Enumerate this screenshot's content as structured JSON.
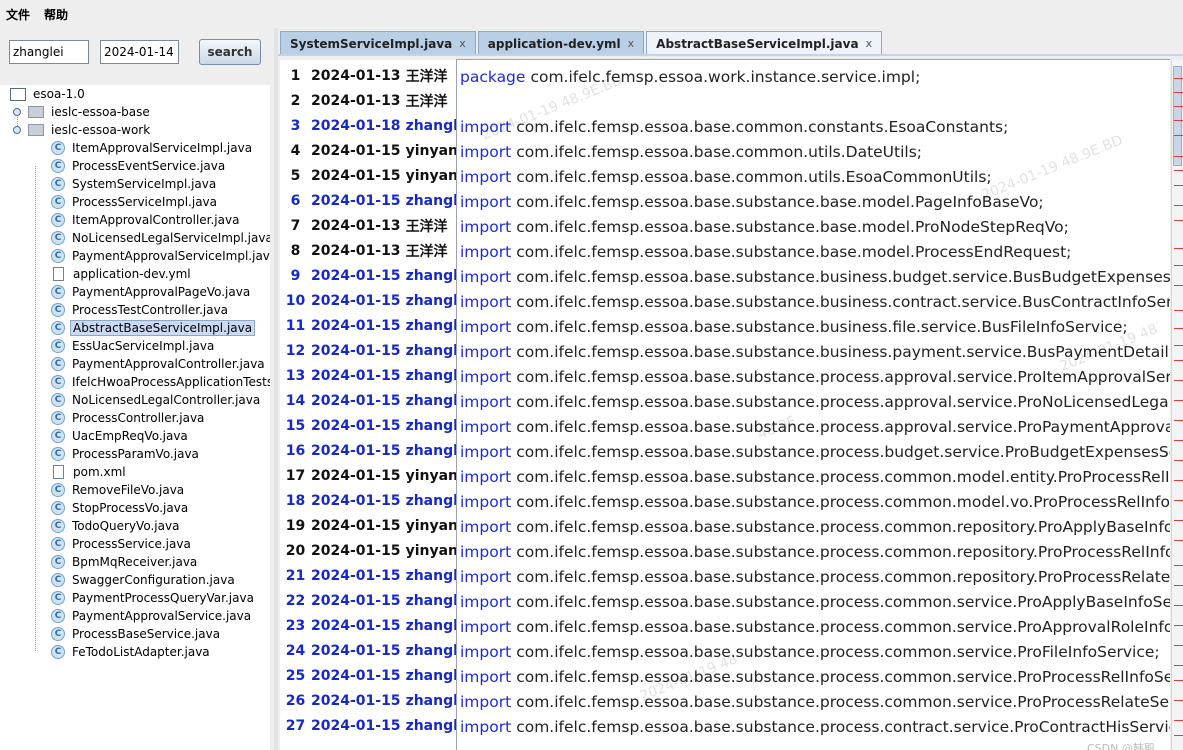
{
  "menu": {
    "items": [
      "文件",
      "帮助"
    ]
  },
  "search": {
    "user_value": "zhanglei",
    "date_value": "2024-01-14",
    "button_label": "search"
  },
  "tree": {
    "root": "esoa-1.0",
    "modules": [
      "ieslc-essoa-base",
      "ieslc-essoa-work"
    ],
    "files": [
      {
        "name": "ItemApprovalServiceImpl.java",
        "type": "class"
      },
      {
        "name": "ProcessEventService.java",
        "type": "class"
      },
      {
        "name": "SystemServiceImpl.java",
        "type": "class"
      },
      {
        "name": "ProcessServiceImpl.java",
        "type": "class"
      },
      {
        "name": "ItemApprovalController.java",
        "type": "class"
      },
      {
        "name": "NoLicensedLegalServiceImpl.java",
        "type": "class"
      },
      {
        "name": "PaymentApprovalServiceImpl.java",
        "type": "class"
      },
      {
        "name": "application-dev.yml",
        "type": "file"
      },
      {
        "name": "PaymentApprovalPageVo.java",
        "type": "class"
      },
      {
        "name": "ProcessTestController.java",
        "type": "class"
      },
      {
        "name": "AbstractBaseServiceImpl.java",
        "type": "class",
        "selected": true
      },
      {
        "name": "EssUacServiceImpl.java",
        "type": "class"
      },
      {
        "name": "PaymentApprovalController.java",
        "type": "class"
      },
      {
        "name": "IfelcHwoaProcessApplicationTests.j",
        "type": "class"
      },
      {
        "name": "NoLicensedLegalController.java",
        "type": "class"
      },
      {
        "name": "ProcessController.java",
        "type": "class"
      },
      {
        "name": "UacEmpReqVo.java",
        "type": "class"
      },
      {
        "name": "ProcessParamVo.java",
        "type": "class"
      },
      {
        "name": "pom.xml",
        "type": "file"
      },
      {
        "name": "RemoveFileVo.java",
        "type": "class"
      },
      {
        "name": "StopProcessVo.java",
        "type": "class"
      },
      {
        "name": "TodoQueryVo.java",
        "type": "class"
      },
      {
        "name": "ProcessService.java",
        "type": "class"
      },
      {
        "name": "BpmMqReceiver.java",
        "type": "class"
      },
      {
        "name": "SwaggerConfiguration.java",
        "type": "class"
      },
      {
        "name": "PaymentProcessQueryVar.java",
        "type": "class"
      },
      {
        "name": "PaymentApprovalService.java",
        "type": "class"
      },
      {
        "name": "ProcessBaseService.java",
        "type": "class"
      },
      {
        "name": "FeTodoListAdapter.java",
        "type": "class"
      }
    ]
  },
  "tabs": [
    {
      "label": "SystemServiceImpl.java",
      "close": "x",
      "active": false
    },
    {
      "label": "application-dev.yml",
      "close": "x",
      "active": false
    },
    {
      "label": "AbstractBaseServiceImpl.java",
      "close": "x",
      "active": true
    }
  ],
  "blame": [
    {
      "line": "1",
      "date": "2024-01-13",
      "author": "王洋洋",
      "color": "black"
    },
    {
      "line": "2",
      "date": "2024-01-13",
      "author": "王洋洋",
      "color": "black"
    },
    {
      "line": "3",
      "date": "2024-01-18",
      "author": "zhanglei",
      "color": "blue"
    },
    {
      "line": "4",
      "date": "2024-01-15",
      "author": "yinyang",
      "color": "black"
    },
    {
      "line": "5",
      "date": "2024-01-15",
      "author": "yinyang",
      "color": "black"
    },
    {
      "line": "6",
      "date": "2024-01-15",
      "author": "zhanglei",
      "color": "blue"
    },
    {
      "line": "7",
      "date": "2024-01-13",
      "author": "王洋洋",
      "color": "black"
    },
    {
      "line": "8",
      "date": "2024-01-13",
      "author": "王洋洋",
      "color": "black"
    },
    {
      "line": "9",
      "date": "2024-01-15",
      "author": "zhanglei",
      "color": "blue"
    },
    {
      "line": "10",
      "date": "2024-01-15",
      "author": "zhanglei",
      "color": "blue"
    },
    {
      "line": "11",
      "date": "2024-01-15",
      "author": "zhanglei",
      "color": "blue"
    },
    {
      "line": "12",
      "date": "2024-01-15",
      "author": "zhanglei",
      "color": "blue"
    },
    {
      "line": "13",
      "date": "2024-01-15",
      "author": "zhanglei",
      "color": "blue"
    },
    {
      "line": "14",
      "date": "2024-01-15",
      "author": "zhanglei",
      "color": "blue"
    },
    {
      "line": "15",
      "date": "2024-01-15",
      "author": "zhanglei",
      "color": "blue"
    },
    {
      "line": "16",
      "date": "2024-01-15",
      "author": "zhanglei",
      "color": "blue"
    },
    {
      "line": "17",
      "date": "2024-01-15",
      "author": "yinyang",
      "color": "black"
    },
    {
      "line": "18",
      "date": "2024-01-15",
      "author": "zhanglei",
      "color": "blue"
    },
    {
      "line": "19",
      "date": "2024-01-15",
      "author": "yinyang",
      "color": "black"
    },
    {
      "line": "20",
      "date": "2024-01-15",
      "author": "yinyang",
      "color": "black"
    },
    {
      "line": "21",
      "date": "2024-01-15",
      "author": "zhanglei",
      "color": "blue"
    },
    {
      "line": "22",
      "date": "2024-01-15",
      "author": "zhanglei",
      "color": "blue"
    },
    {
      "line": "23",
      "date": "2024-01-15",
      "author": "zhanglei",
      "color": "blue"
    },
    {
      "line": "24",
      "date": "2024-01-15",
      "author": "zhanglei",
      "color": "blue"
    },
    {
      "line": "25",
      "date": "2024-01-15",
      "author": "zhanglei",
      "color": "blue"
    },
    {
      "line": "26",
      "date": "2024-01-15",
      "author": "zhanglei",
      "color": "blue"
    },
    {
      "line": "27",
      "date": "2024-01-15",
      "author": "zhanglei",
      "color": "blue"
    }
  ],
  "code": [
    {
      "kw": "package",
      "text": "com.ifelc.femsp.essoa.work.instance.service.impl;"
    },
    {
      "kw": "",
      "text": ""
    },
    {
      "kw": "import",
      "text": "com.ifelc.femsp.essoa.base.common.constants.EsoaConstants;"
    },
    {
      "kw": "import",
      "text": "com.ifelc.femsp.essoa.base.common.utils.DateUtils;"
    },
    {
      "kw": "import",
      "text": "com.ifelc.femsp.essoa.base.common.utils.EsoaCommonUtils;"
    },
    {
      "kw": "import",
      "text": "com.ifelc.femsp.essoa.base.substance.base.model.PageInfoBaseVo;"
    },
    {
      "kw": "import",
      "text": "com.ifelc.femsp.essoa.base.substance.base.model.ProNodeStepReqVo;"
    },
    {
      "kw": "import",
      "text": "com.ifelc.femsp.essoa.base.substance.base.model.ProcessEndRequest;"
    },
    {
      "kw": "import",
      "text": "com.ifelc.femsp.essoa.base.substance.business.budget.service.BusBudgetExpensesSe"
    },
    {
      "kw": "import",
      "text": "com.ifelc.femsp.essoa.base.substance.business.contract.service.BusContractInfoServic"
    },
    {
      "kw": "import",
      "text": "com.ifelc.femsp.essoa.base.substance.business.file.service.BusFileInfoService;"
    },
    {
      "kw": "import",
      "text": "com.ifelc.femsp.essoa.base.substance.business.payment.service.BusPaymentDetailSer"
    },
    {
      "kw": "import",
      "text": "com.ifelc.femsp.essoa.base.substance.process.approval.service.ProItemApprovalServic"
    },
    {
      "kw": "import",
      "text": "com.ifelc.femsp.essoa.base.substance.process.approval.service.ProNoLicensedLegalRe"
    },
    {
      "kw": "import",
      "text": "com.ifelc.femsp.essoa.base.substance.process.approval.service.ProPaymentApprovalS"
    },
    {
      "kw": "import",
      "text": "com.ifelc.femsp.essoa.base.substance.process.budget.service.ProBudgetExpensesServ"
    },
    {
      "kw": "import",
      "text": "com.ifelc.femsp.essoa.base.substance.process.common.model.entity.ProProcessRelInf"
    },
    {
      "kw": "import",
      "text": "com.ifelc.femsp.essoa.base.substance.process.common.model.vo.ProProcessRelInfoVo"
    },
    {
      "kw": "import",
      "text": "com.ifelc.femsp.essoa.base.substance.process.common.repository.ProApplyBaseInfoRe"
    },
    {
      "kw": "import",
      "text": "com.ifelc.femsp.essoa.base.substance.process.common.repository.ProProcessRelInfoR"
    },
    {
      "kw": "import",
      "text": "com.ifelc.femsp.essoa.base.substance.process.common.repository.ProProcessRelateR"
    },
    {
      "kw": "import",
      "text": "com.ifelc.femsp.essoa.base.substance.process.common.service.ProApplyBaseInfoServ"
    },
    {
      "kw": "import",
      "text": "com.ifelc.femsp.essoa.base.substance.process.common.service.ProApprovalRoleInfoSe"
    },
    {
      "kw": "import",
      "text": "com.ifelc.femsp.essoa.base.substance.process.common.service.ProFileInfoService;"
    },
    {
      "kw": "import",
      "text": "com.ifelc.femsp.essoa.base.substance.process.common.service.ProProcessRelInfoSer"
    },
    {
      "kw": "import",
      "text": "com.ifelc.femsp.essoa.base.substance.process.common.service.ProProcessRelateServ"
    },
    {
      "kw": "import",
      "text": "com.ifelc.femsp.essoa.base.substance.process.contract.service.ProContractHisService"
    }
  ],
  "watermarks": [
    "2024-01-19 48.9E.BD",
    "48.9E",
    "2024-01-19 48",
    "CSDN @韩殿"
  ]
}
